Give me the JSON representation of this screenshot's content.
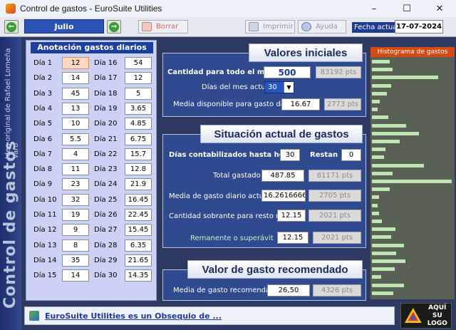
{
  "window": {
    "title": "Control de gastos - EuroSuite Utilities"
  },
  "toolbar": {
    "month": "Julio",
    "borrar": "Borrar",
    "imprimir": "Imprimir",
    "ayuda": "Ayuda",
    "date_label": "Fecha actual:",
    "date_value": "17-07-2024"
  },
  "sidebar": {
    "title": "Control de gastos",
    "subtitle": "Idea original de Rafael Lomeña Varo"
  },
  "daily": {
    "title": "Anotación gastos diarios",
    "left": [
      {
        "label": "Día 1",
        "value": "12"
      },
      {
        "label": "Día 2",
        "value": "14"
      },
      {
        "label": "Día 3",
        "value": "45"
      },
      {
        "label": "Día 4",
        "value": "13"
      },
      {
        "label": "Día 5",
        "value": "10"
      },
      {
        "label": "Día 6",
        "value": "5.5"
      },
      {
        "label": "Día 7",
        "value": "4"
      },
      {
        "label": "Día 8",
        "value": "11"
      },
      {
        "label": "Día 9",
        "value": "23"
      },
      {
        "label": "Día 10",
        "value": "32"
      },
      {
        "label": "Día 11",
        "value": "19"
      },
      {
        "label": "Día 12",
        "value": "9"
      },
      {
        "label": "Día 13",
        "value": "8"
      },
      {
        "label": "Día 14",
        "value": "35"
      },
      {
        "label": "Día 15",
        "value": "14"
      }
    ],
    "right": [
      {
        "label": "Día 16",
        "value": "54"
      },
      {
        "label": "Día 17",
        "value": "12"
      },
      {
        "label": "Día 18",
        "value": "5"
      },
      {
        "label": "Día 19",
        "value": "3.65"
      },
      {
        "label": "Día 20",
        "value": "4.85"
      },
      {
        "label": "Día 21",
        "value": "6.75"
      },
      {
        "label": "Día 22",
        "value": "15.7"
      },
      {
        "label": "Día 23",
        "value": "12.8"
      },
      {
        "label": "Día 24",
        "value": "21.9"
      },
      {
        "label": "Día 25",
        "value": "16.45"
      },
      {
        "label": "Día 26",
        "value": "22.45"
      },
      {
        "label": "Día 27",
        "value": "15.45"
      },
      {
        "label": "Día 28",
        "value": "6.35"
      },
      {
        "label": "Día 29",
        "value": "21.65"
      },
      {
        "label": "Día 30",
        "value": "14.35"
      }
    ]
  },
  "initial": {
    "title": "Valores iniciales",
    "amount_label": "Cantidad para todo el mes",
    "amount": "500",
    "amount_pts": "83192 pts",
    "days_label": "Días del mes actual",
    "days": "30",
    "avg_label": "Media disponible para gasto diario",
    "avg": "16.67",
    "avg_pts": "2773 pts"
  },
  "current": {
    "title": "Situación actual de gastos",
    "counted_label": "Días contabilizados hasta hoy",
    "counted": "30",
    "remaining_label": "Restan",
    "remaining": "0",
    "total_label": "Total gastado",
    "total": "487.85",
    "total_pts": "81171 pts",
    "daily_avg_label": "Media de gasto diario actual",
    "daily_avg": "16.26166666",
    "daily_avg_pts": "2705 pts",
    "leftover_label": "Cantidad sobrante para resto mes",
    "leftover": "12.15",
    "leftover_pts": "2021 pts",
    "surplus_label": "Remanente o superávit",
    "surplus": "12.15",
    "surplus_pts": "2021 pts"
  },
  "recommended": {
    "title": "Valor de gasto recomendado",
    "label": "Media de gasto recomendada",
    "value": "26,50",
    "pts": "4326 pts"
  },
  "histogram": {
    "title": "Histograma de gastos",
    "values": [
      12,
      14,
      45,
      13,
      10,
      5.5,
      4,
      11,
      23,
      32,
      19,
      9,
      8,
      35,
      14,
      54,
      12,
      5,
      3.65,
      4.85,
      6.75,
      15.7,
      12.8,
      21.9,
      16.45,
      22.45,
      15.45,
      6.35,
      21.65,
      14.35
    ],
    "max": 54
  },
  "footer": {
    "link": "EuroSuite Utilities es un Obsequio de ...",
    "logo_line1": "AQUÍ SU",
    "logo_line2": "LOGO"
  }
}
